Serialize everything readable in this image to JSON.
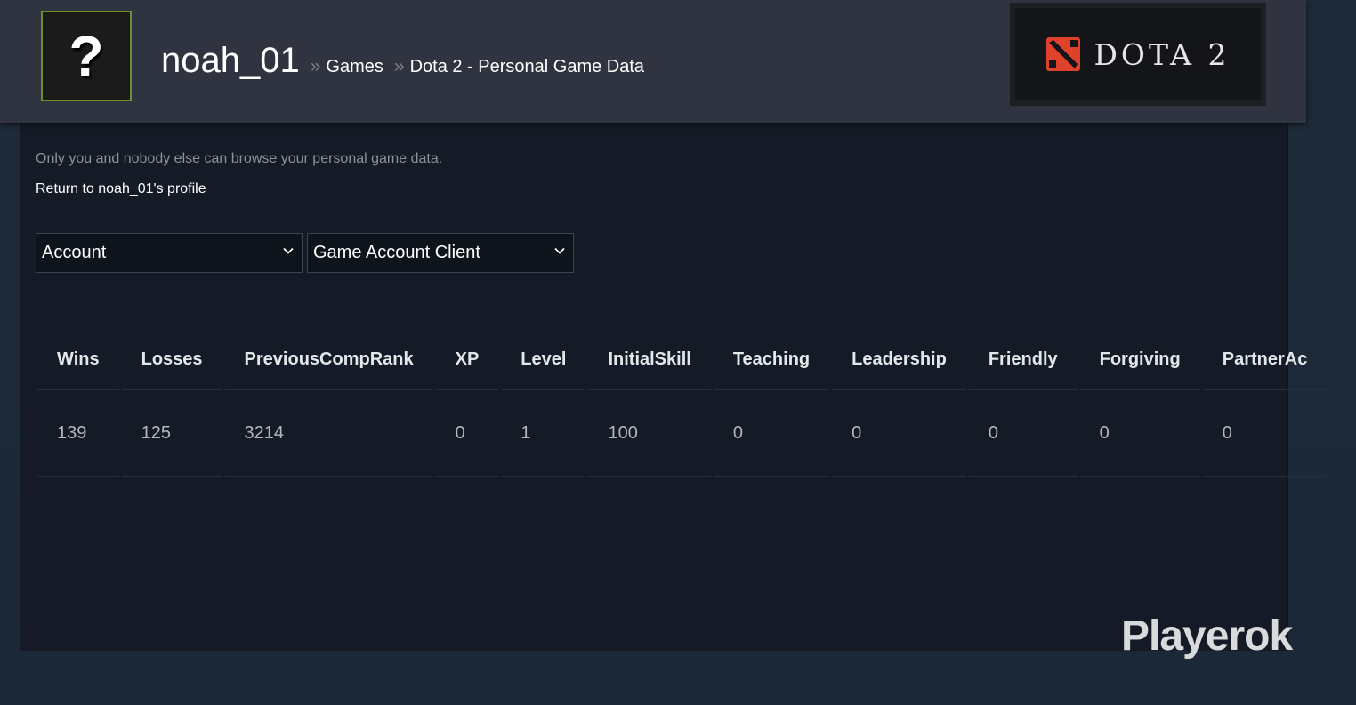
{
  "header": {
    "avatar_glyph": "?",
    "persona_name": "noah_01",
    "separator": "»",
    "crumb_games": "Games",
    "crumb_current": "Dota 2 - Personal Game Data",
    "game_logo_text": "DOTA 2"
  },
  "content": {
    "notice": "Only you and nobody else can browse your personal game data.",
    "return_link": "Return to noah_01's profile"
  },
  "filters": {
    "category_selected": "Account",
    "subcategory_selected": "Game Account Client"
  },
  "table": {
    "columns": [
      "Wins",
      "Losses",
      "PreviousCompRank",
      "XP",
      "Level",
      "InitialSkill",
      "Teaching",
      "Leadership",
      "Friendly",
      "Forgiving",
      "PartnerAc"
    ],
    "rows": [
      [
        "139",
        "125",
        "3214",
        "0",
        "1",
        "100",
        "0",
        "0",
        "0",
        "0",
        "0"
      ]
    ]
  },
  "watermark": "Playerok",
  "colors": {
    "background": "#1b2838",
    "header": "#303440",
    "panel": "#141b26",
    "avatar_border": "#6e8f2a",
    "dota_red": "#e0412b"
  },
  "icons": {
    "dropdown": "chevron-down-icon",
    "game_logo": "dota-emblem-icon"
  }
}
